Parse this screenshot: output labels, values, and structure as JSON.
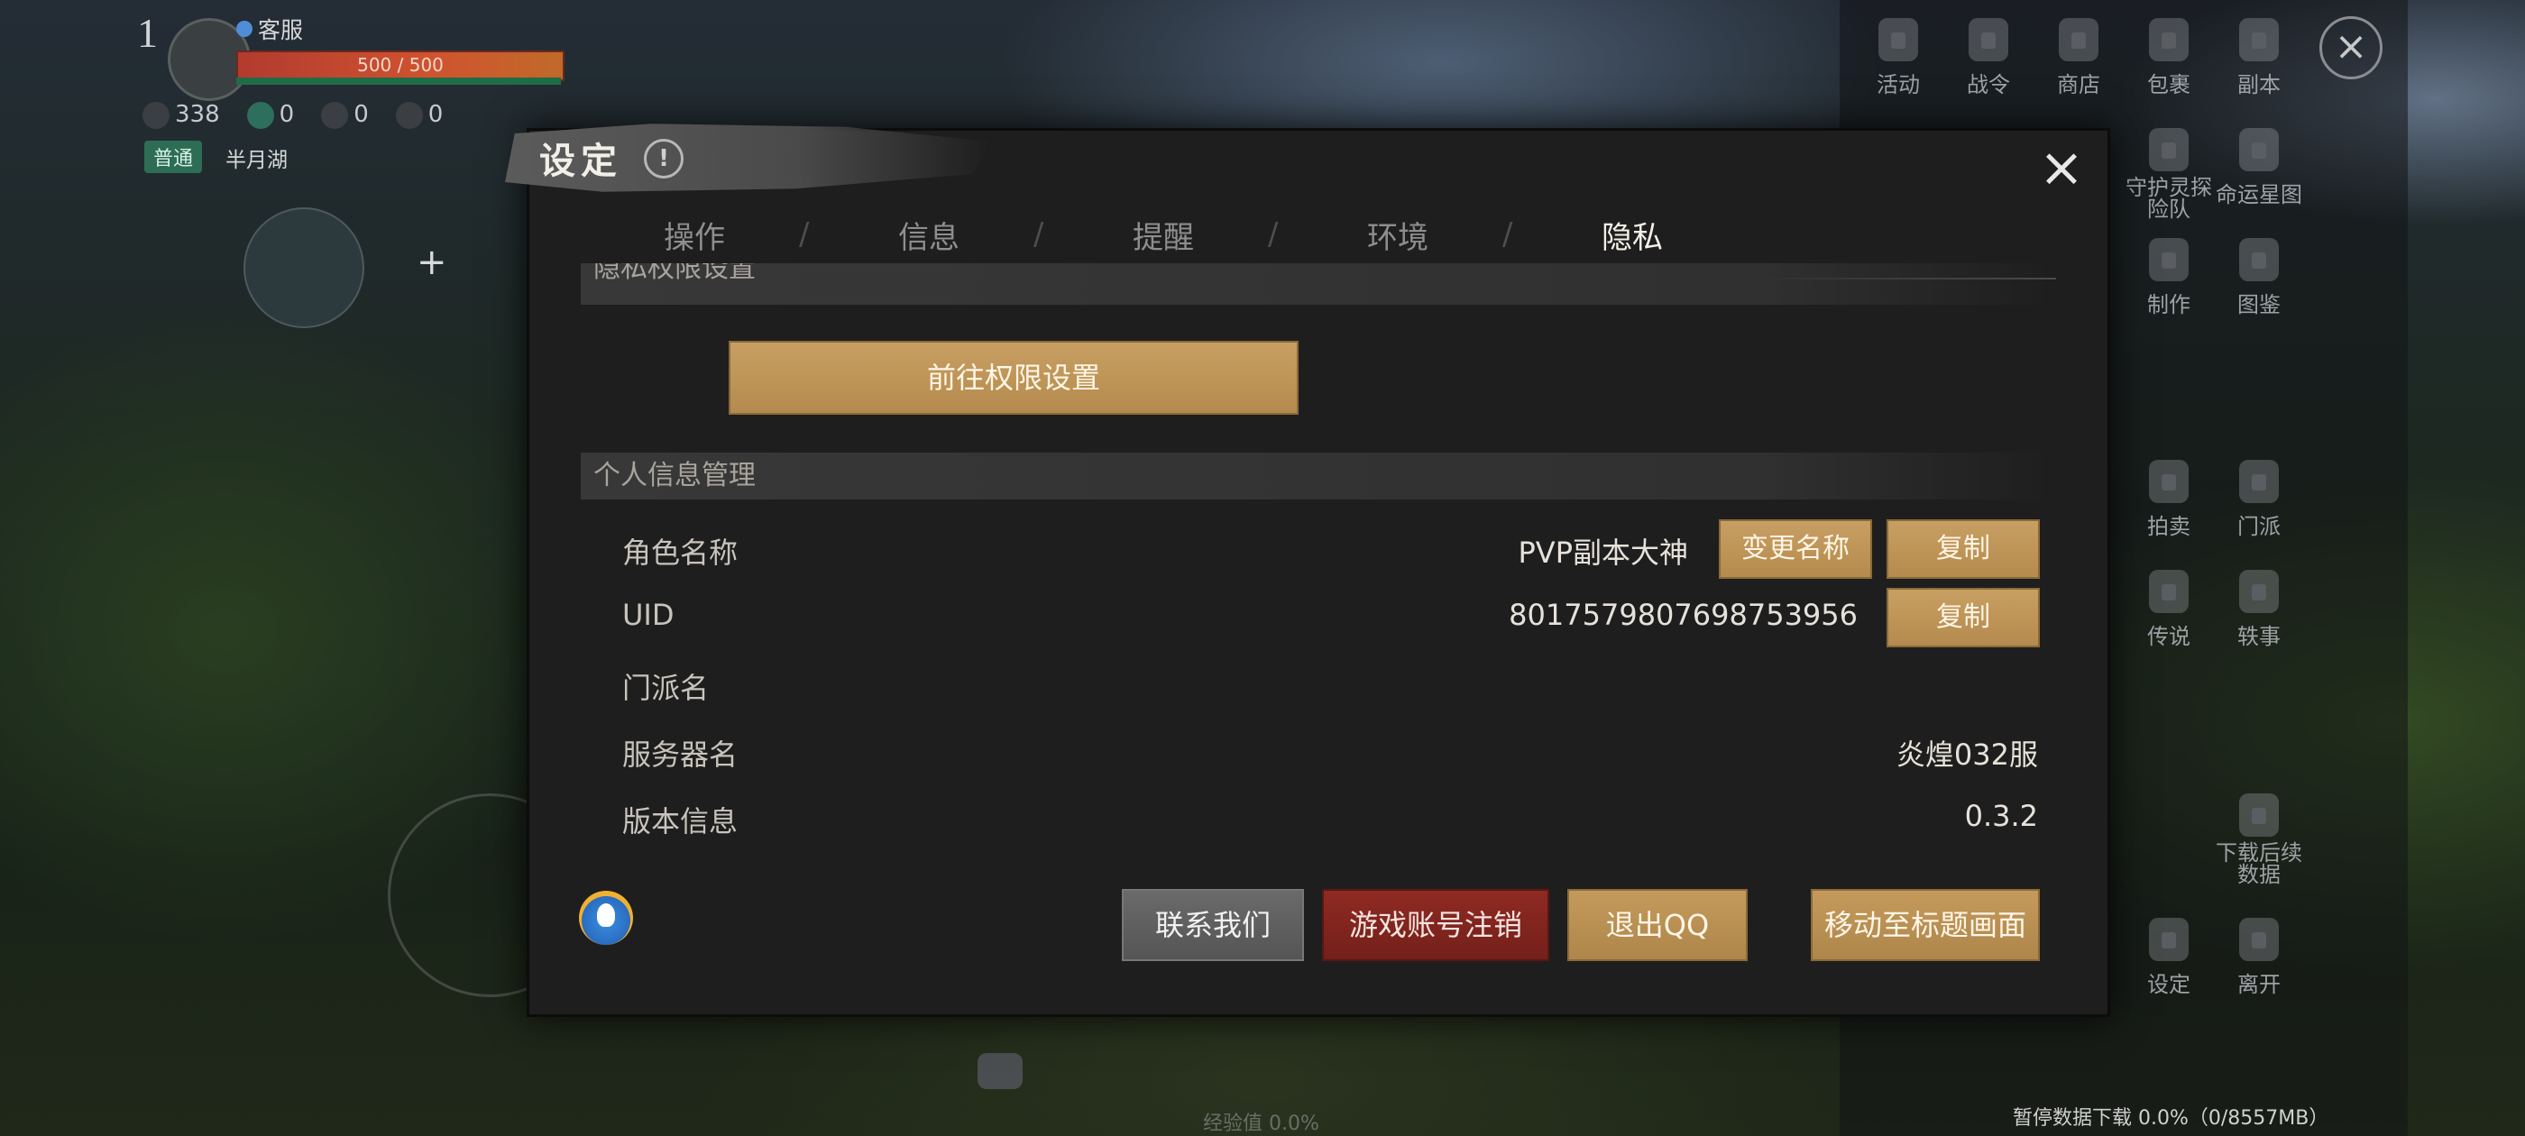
{
  "hud": {
    "level": "1",
    "customer_service": "客服",
    "hp_text": "500 / 500",
    "stat1": "338",
    "stat2": "0",
    "stat3": "0",
    "stat4": "0",
    "mode_tag": "普通",
    "location": "半月湖"
  },
  "side_menu": {
    "items": [
      "活动",
      "战令",
      "商店",
      "包裹",
      "副本",
      "守护灵探险队",
      "命运星图",
      "制作",
      "图鉴",
      "拍卖",
      "门派",
      "传说",
      "轶事",
      "下载后续数据",
      "设定",
      "离开"
    ]
  },
  "bottom": {
    "download_status": "暂停数据下载 0.0%（0/8557MB）",
    "exp": "经验值 0.0%"
  },
  "dialog": {
    "title": "设定",
    "info_icon": "!",
    "tabs": [
      "操作",
      "信息",
      "提醒",
      "环境",
      "隐私"
    ],
    "active_tab": "隐私",
    "privacy_section": "隐私权限设置",
    "goto_permission_button": "前往权限设置",
    "personal_section": "个人信息管理",
    "rows": [
      {
        "label": "角色名称",
        "value": "PVP副本大神"
      },
      {
        "label": "UID",
        "value": "8017579807698753956"
      },
      {
        "label": "门派名",
        "value": ""
      },
      {
        "label": "服务器名",
        "value": "炎煌032服"
      },
      {
        "label": "版本信息",
        "value": "0.3.2"
      }
    ],
    "rename_button": "变更名称",
    "copy_button": "复制",
    "footer_buttons": {
      "contact": "联系我们",
      "deregister": "游戏账号注销",
      "logout_qq": "退出QQ",
      "title_screen": "移动至标题画面"
    }
  }
}
